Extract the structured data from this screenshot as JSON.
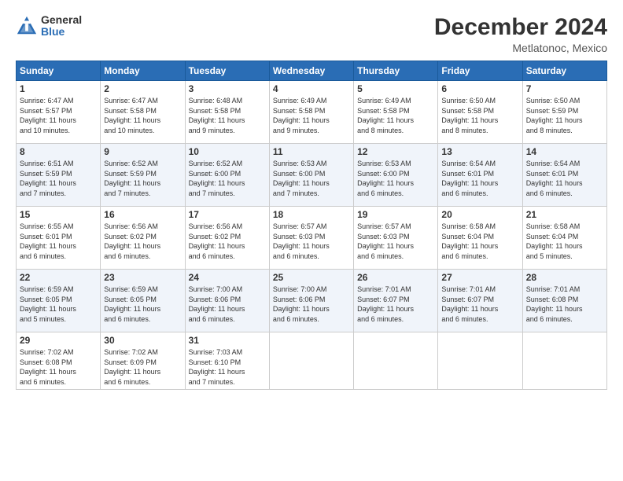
{
  "header": {
    "logo_general": "General",
    "logo_blue": "Blue",
    "month_title": "December 2024",
    "subtitle": "Metlatonoc, Mexico"
  },
  "weekdays": [
    "Sunday",
    "Monday",
    "Tuesday",
    "Wednesday",
    "Thursday",
    "Friday",
    "Saturday"
  ],
  "weeks": [
    [
      {
        "day": "1",
        "lines": [
          "Sunrise: 6:47 AM",
          "Sunset: 5:57 PM",
          "Daylight: 11 hours",
          "and 10 minutes."
        ]
      },
      {
        "day": "2",
        "lines": [
          "Sunrise: 6:47 AM",
          "Sunset: 5:58 PM",
          "Daylight: 11 hours",
          "and 10 minutes."
        ]
      },
      {
        "day": "3",
        "lines": [
          "Sunrise: 6:48 AM",
          "Sunset: 5:58 PM",
          "Daylight: 11 hours",
          "and 9 minutes."
        ]
      },
      {
        "day": "4",
        "lines": [
          "Sunrise: 6:49 AM",
          "Sunset: 5:58 PM",
          "Daylight: 11 hours",
          "and 9 minutes."
        ]
      },
      {
        "day": "5",
        "lines": [
          "Sunrise: 6:49 AM",
          "Sunset: 5:58 PM",
          "Daylight: 11 hours",
          "and 8 minutes."
        ]
      },
      {
        "day": "6",
        "lines": [
          "Sunrise: 6:50 AM",
          "Sunset: 5:58 PM",
          "Daylight: 11 hours",
          "and 8 minutes."
        ]
      },
      {
        "day": "7",
        "lines": [
          "Sunrise: 6:50 AM",
          "Sunset: 5:59 PM",
          "Daylight: 11 hours",
          "and 8 minutes."
        ]
      }
    ],
    [
      {
        "day": "8",
        "lines": [
          "Sunrise: 6:51 AM",
          "Sunset: 5:59 PM",
          "Daylight: 11 hours",
          "and 7 minutes."
        ]
      },
      {
        "day": "9",
        "lines": [
          "Sunrise: 6:52 AM",
          "Sunset: 5:59 PM",
          "Daylight: 11 hours",
          "and 7 minutes."
        ]
      },
      {
        "day": "10",
        "lines": [
          "Sunrise: 6:52 AM",
          "Sunset: 6:00 PM",
          "Daylight: 11 hours",
          "and 7 minutes."
        ]
      },
      {
        "day": "11",
        "lines": [
          "Sunrise: 6:53 AM",
          "Sunset: 6:00 PM",
          "Daylight: 11 hours",
          "and 7 minutes."
        ]
      },
      {
        "day": "12",
        "lines": [
          "Sunrise: 6:53 AM",
          "Sunset: 6:00 PM",
          "Daylight: 11 hours",
          "and 6 minutes."
        ]
      },
      {
        "day": "13",
        "lines": [
          "Sunrise: 6:54 AM",
          "Sunset: 6:01 PM",
          "Daylight: 11 hours",
          "and 6 minutes."
        ]
      },
      {
        "day": "14",
        "lines": [
          "Sunrise: 6:54 AM",
          "Sunset: 6:01 PM",
          "Daylight: 11 hours",
          "and 6 minutes."
        ]
      }
    ],
    [
      {
        "day": "15",
        "lines": [
          "Sunrise: 6:55 AM",
          "Sunset: 6:01 PM",
          "Daylight: 11 hours",
          "and 6 minutes."
        ]
      },
      {
        "day": "16",
        "lines": [
          "Sunrise: 6:56 AM",
          "Sunset: 6:02 PM",
          "Daylight: 11 hours",
          "and 6 minutes."
        ]
      },
      {
        "day": "17",
        "lines": [
          "Sunrise: 6:56 AM",
          "Sunset: 6:02 PM",
          "Daylight: 11 hours",
          "and 6 minutes."
        ]
      },
      {
        "day": "18",
        "lines": [
          "Sunrise: 6:57 AM",
          "Sunset: 6:03 PM",
          "Daylight: 11 hours",
          "and 6 minutes."
        ]
      },
      {
        "day": "19",
        "lines": [
          "Sunrise: 6:57 AM",
          "Sunset: 6:03 PM",
          "Daylight: 11 hours",
          "and 6 minutes."
        ]
      },
      {
        "day": "20",
        "lines": [
          "Sunrise: 6:58 AM",
          "Sunset: 6:04 PM",
          "Daylight: 11 hours",
          "and 6 minutes."
        ]
      },
      {
        "day": "21",
        "lines": [
          "Sunrise: 6:58 AM",
          "Sunset: 6:04 PM",
          "Daylight: 11 hours",
          "and 5 minutes."
        ]
      }
    ],
    [
      {
        "day": "22",
        "lines": [
          "Sunrise: 6:59 AM",
          "Sunset: 6:05 PM",
          "Daylight: 11 hours",
          "and 5 minutes."
        ]
      },
      {
        "day": "23",
        "lines": [
          "Sunrise: 6:59 AM",
          "Sunset: 6:05 PM",
          "Daylight: 11 hours",
          "and 6 minutes."
        ]
      },
      {
        "day": "24",
        "lines": [
          "Sunrise: 7:00 AM",
          "Sunset: 6:06 PM",
          "Daylight: 11 hours",
          "and 6 minutes."
        ]
      },
      {
        "day": "25",
        "lines": [
          "Sunrise: 7:00 AM",
          "Sunset: 6:06 PM",
          "Daylight: 11 hours",
          "and 6 minutes."
        ]
      },
      {
        "day": "26",
        "lines": [
          "Sunrise: 7:01 AM",
          "Sunset: 6:07 PM",
          "Daylight: 11 hours",
          "and 6 minutes."
        ]
      },
      {
        "day": "27",
        "lines": [
          "Sunrise: 7:01 AM",
          "Sunset: 6:07 PM",
          "Daylight: 11 hours",
          "and 6 minutes."
        ]
      },
      {
        "day": "28",
        "lines": [
          "Sunrise: 7:01 AM",
          "Sunset: 6:08 PM",
          "Daylight: 11 hours",
          "and 6 minutes."
        ]
      }
    ],
    [
      {
        "day": "29",
        "lines": [
          "Sunrise: 7:02 AM",
          "Sunset: 6:08 PM",
          "Daylight: 11 hours",
          "and 6 minutes."
        ]
      },
      {
        "day": "30",
        "lines": [
          "Sunrise: 7:02 AM",
          "Sunset: 6:09 PM",
          "Daylight: 11 hours",
          "and 6 minutes."
        ]
      },
      {
        "day": "31",
        "lines": [
          "Sunrise: 7:03 AM",
          "Sunset: 6:10 PM",
          "Daylight: 11 hours",
          "and 7 minutes."
        ]
      },
      {
        "day": "",
        "lines": []
      },
      {
        "day": "",
        "lines": []
      },
      {
        "day": "",
        "lines": []
      },
      {
        "day": "",
        "lines": []
      }
    ]
  ]
}
